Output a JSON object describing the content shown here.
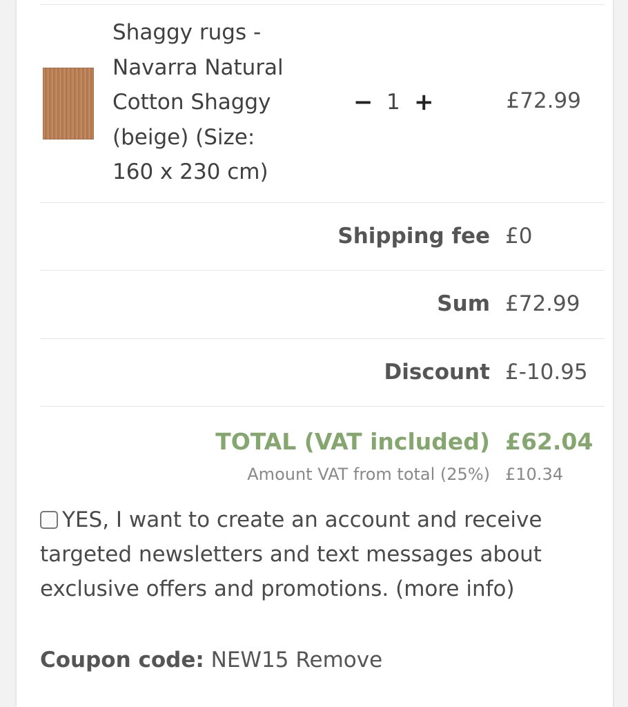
{
  "cart_item": {
    "name_lines": [
      "Shaggy rugs -",
      "Navarra Natural",
      "Cotton Shaggy",
      "(beige) (Size:",
      "160 x 230 cm)"
    ],
    "quantity": "1",
    "minus_symbol": "−",
    "plus_symbol": "+",
    "price": "£72.99",
    "image_icon": "rug-thumbnail-icon"
  },
  "summary": {
    "shipping_label": "Shipping fee",
    "shipping_value": "£0",
    "sum_label": "Sum",
    "sum_value": "£72.99",
    "discount_label": "Discount",
    "discount_value": "£-10.95",
    "total_label": "TOTAL (VAT included)",
    "total_value": "£62.04",
    "vat_label": "Amount VAT from total (25%)",
    "vat_value": "£10.34"
  },
  "optin": {
    "text": "YES, I want to create an account and receive targeted newsletters and text messages about exclusive offers and promotions.",
    "link": "(more info)"
  },
  "coupon": {
    "label": "Coupon code:",
    "code": "NEW15",
    "remove": "Remove"
  },
  "colors": {
    "total_green": "#86a670",
    "text_gray": "#555555",
    "rule_gray": "#e6e6e6"
  }
}
